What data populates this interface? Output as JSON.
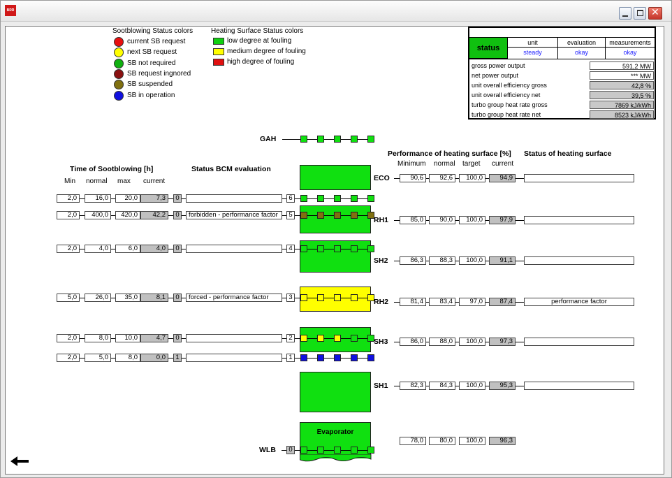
{
  "window": {
    "app_icon": "app-logo-icon",
    "controls": [
      "minimize",
      "maximize",
      "close"
    ]
  },
  "legend": {
    "sb_title": "Sootblowing Status colors",
    "sb_items": [
      {
        "label": "current SB request",
        "color": "#e81010"
      },
      {
        "label": "next SB request",
        "color": "#ffff00"
      },
      {
        "label": "SB not required",
        "color": "#10b010"
      },
      {
        "label": "SB request ingnored",
        "color": "#8a1010"
      },
      {
        "label": "SB suspended",
        "color": "#807010"
      },
      {
        "label": "SB in operation",
        "color": "#1010e0"
      }
    ],
    "hs_title": "Heating Surface Status colors",
    "hs_items": [
      {
        "label": "low degree at fouling",
        "color": "#10d010"
      },
      {
        "label": "medium degree of fouling",
        "color": "#ffff00"
      },
      {
        "label": "high degree of fouling",
        "color": "#e01010"
      }
    ]
  },
  "status_table": {
    "status_label": "status",
    "col_headers": [
      "unit",
      "evaluation",
      "measurements"
    ],
    "col_values": [
      "steady",
      "okay",
      "okay"
    ],
    "rows": [
      {
        "label": "gross power output",
        "value": "591,2 MW"
      },
      {
        "label": "net power output",
        "value": "*** MW"
      },
      {
        "label": "unit overall efficiency gross",
        "value": "42,8 %"
      },
      {
        "label": "unit overall efficiency net",
        "value": "39,5 %"
      },
      {
        "label": "turbo group heat rate gross",
        "value": "7869 kJ/kWh"
      },
      {
        "label": "turbo group heat rate net",
        "value": "8523 kJ/kWh"
      }
    ]
  },
  "headers": {
    "time_title": "Time of Sootblowing [h]",
    "time_cols": [
      "Min",
      "normal",
      "max",
      "current"
    ],
    "bcm_title": "Status BCM evaluation",
    "perf_title": "Performance of heating surface [%]",
    "perf_cols": [
      "Minimum",
      "normal",
      "target",
      "current"
    ],
    "status_hs_title": "Status of heating surface"
  },
  "gah_label": "GAH",
  "evaporator_label": "Evaporator",
  "wlb": {
    "label": "WLB",
    "count": "0"
  },
  "sb_rows": [
    {
      "min": "2,0",
      "normal": "16,0",
      "max": "20,0",
      "current": "7,3",
      "count": "0",
      "bcm": "",
      "num": "6"
    },
    {
      "min": "2,0",
      "normal": "400,0",
      "max": "420,0",
      "current": "42,2",
      "count": "0",
      "bcm": "forbidden - performance factor",
      "num": "5"
    },
    {
      "min": "2,0",
      "normal": "4,0",
      "max": "6,0",
      "current": "4,0",
      "count": "0",
      "bcm": "",
      "num": "4"
    },
    {
      "min": "5,0",
      "normal": "26,0",
      "max": "35,0",
      "current": "8,1",
      "count": "0",
      "bcm": "forced - performance factor",
      "num": "3"
    },
    {
      "min": "2,0",
      "normal": "8,0",
      "max": "10,0",
      "current": "4,7",
      "count": "0",
      "bcm": "",
      "num": "2"
    },
    {
      "min": "2,0",
      "normal": "5,0",
      "max": "8,0",
      "current": "0,0",
      "count": "1",
      "bcm": "",
      "num": "1"
    }
  ],
  "hs_rows": [
    {
      "label": "ECO",
      "min": "90,6",
      "normal": "92,6",
      "target": "100,0",
      "current": "94,9",
      "status": ""
    },
    {
      "label": "RH1",
      "min": "85,0",
      "normal": "90,0",
      "target": "100,0",
      "current": "97,9",
      "status": ""
    },
    {
      "label": "SH2",
      "min": "86,3",
      "normal": "88,3",
      "target": "100,0",
      "current": "91,1",
      "status": ""
    },
    {
      "label": "RH2",
      "min": "81,4",
      "normal": "83,4",
      "target": "97,0",
      "current": "87,4",
      "status": "performance factor"
    },
    {
      "label": "SH3",
      "min": "86,0",
      "normal": "88,0",
      "target": "100,0",
      "current": "97,3",
      "status": ""
    },
    {
      "label": "SH1",
      "min": "82,3",
      "normal": "84,3",
      "target": "100,0",
      "current": "95,3",
      "status": ""
    },
    {
      "label": "",
      "min": "78,0",
      "normal": "80,0",
      "target": "100,0",
      "current": "96,3",
      "status": null
    }
  ],
  "nav": {
    "back_icon": "arrow-left-icon"
  }
}
